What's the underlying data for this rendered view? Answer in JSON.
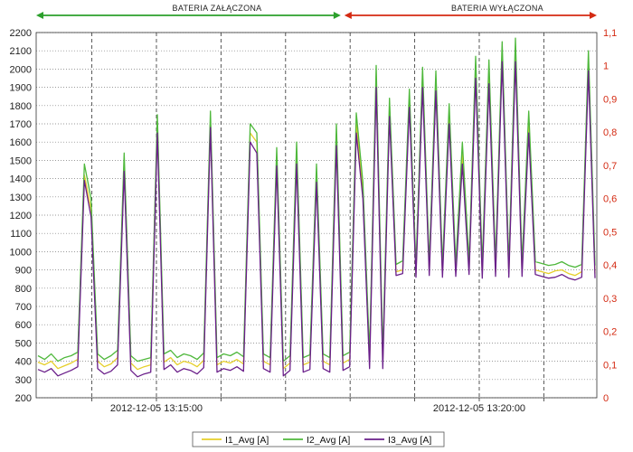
{
  "chart_data": {
    "type": "line",
    "annotations": [
      {
        "text": "BATERIA ZAŁĄCZONA",
        "color": "#2ca02c",
        "span": [
          "start",
          "2012-12-05 13:17:53"
        ]
      },
      {
        "text": "BATERIA WYŁĄCZONA",
        "color": "#d42a12",
        "span": [
          "2012-12-05 13:17:53",
          "end"
        ]
      }
    ],
    "x_ticks": [
      "2012-12-05 13:15:00",
      "2012-12-05 13:20:00"
    ],
    "y_left": {
      "min": 200,
      "max": 2200,
      "step": 100
    },
    "y_right": {
      "min": 0,
      "max": 1.1,
      "step": 0.1,
      "color": "#d42a12"
    },
    "grid": true,
    "legend_position": "bottom",
    "series": [
      {
        "name": "I1_Avg [A]",
        "color": "#e6cf2a",
        "values": [
          395,
          380,
          400,
          360,
          375,
          390,
          410,
          1420,
          1230,
          400,
          370,
          385,
          420,
          1490,
          390,
          355,
          370,
          380,
          1700,
          395,
          420,
          380,
          400,
          390,
          370,
          405,
          1720,
          380,
          400,
          390,
          410,
          385,
          1650,
          1600,
          400,
          380,
          1520,
          360,
          390,
          1540,
          380,
          395,
          1430,
          400,
          380,
          1640,
          390,
          410,
          1700,
          1330,
          400,
          1960,
          400,
          1790,
          890,
          900,
          1840,
          880,
          1960,
          895,
          1930,
          880,
          1760,
          890,
          1540,
          900,
          2000,
          880,
          1980,
          890,
          2090,
          880,
          2100,
          890,
          1710,
          900,
          890,
          880,
          895,
          900,
          880,
          870,
          890,
          2040,
          880
        ]
      },
      {
        "name": "I2_Avg [A]",
        "color": "#4fb83c",
        "values": [
          430,
          410,
          440,
          400,
          420,
          430,
          450,
          1480,
          1290,
          440,
          410,
          430,
          460,
          1540,
          430,
          400,
          410,
          420,
          1750,
          440,
          460,
          420,
          440,
          430,
          410,
          445,
          1770,
          420,
          440,
          430,
          450,
          425,
          1700,
          1650,
          440,
          420,
          1570,
          400,
          430,
          1600,
          420,
          435,
          1480,
          440,
          420,
          1700,
          430,
          450,
          1760,
          1380,
          440,
          2020,
          440,
          1840,
          930,
          950,
          1890,
          920,
          2010,
          935,
          1990,
          925,
          1810,
          930,
          1600,
          945,
          2070,
          925,
          2050,
          935,
          2150,
          925,
          2170,
          935,
          1770,
          945,
          935,
          925,
          930,
          945,
          925,
          915,
          930,
          2100,
          925
        ]
      },
      {
        "name": "I3_Avg [A]",
        "color": "#6a1f8a",
        "values": [
          355,
          340,
          360,
          320,
          335,
          350,
          370,
          1390,
          1190,
          360,
          330,
          345,
          380,
          1440,
          350,
          315,
          330,
          340,
          1650,
          355,
          380,
          340,
          360,
          350,
          330,
          365,
          1680,
          340,
          360,
          350,
          370,
          345,
          1600,
          1540,
          360,
          340,
          1470,
          320,
          350,
          1480,
          340,
          355,
          1380,
          360,
          340,
          1580,
          350,
          370,
          1650,
          1290,
          360,
          1900,
          360,
          1740,
          870,
          880,
          1790,
          860,
          1900,
          870,
          1880,
          860,
          1700,
          865,
          1480,
          875,
          1950,
          855,
          1920,
          865,
          2040,
          860,
          2040,
          865,
          1650,
          875,
          865,
          855,
          860,
          875,
          855,
          845,
          860,
          1990,
          855
        ]
      }
    ]
  }
}
